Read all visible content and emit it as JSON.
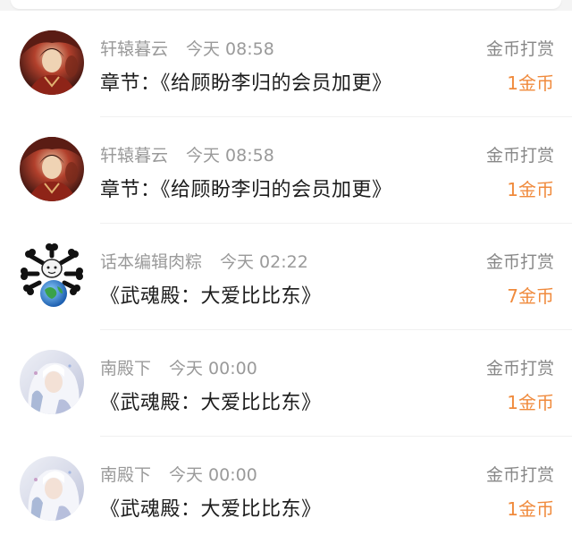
{
  "accent_color": "#f08a3c",
  "records": [
    {
      "username": "轩辕暮云",
      "time": "今天 08:58",
      "content": "章节：《给顾盼李归的会员加更》",
      "action": "金币打赏",
      "amount": "1金币",
      "avatar_icon": "anime-warrior-avatar-icon"
    },
    {
      "username": "轩辕暮云",
      "time": "今天 08:58",
      "content": "章节：《给顾盼李归的会员加更》",
      "action": "金币打赏",
      "amount": "1金币",
      "avatar_icon": "anime-warrior-avatar-icon"
    },
    {
      "username": "话本编辑肉粽",
      "time": "今天 02:22",
      "content": "《武魂殿：大爱比比东》",
      "action": "金币打赏",
      "amount": "7金币",
      "avatar_icon": "cartoon-earth-avatar-icon"
    },
    {
      "username": "南殿下",
      "time": "今天 00:00",
      "content": "《武魂殿：大爱比比东》",
      "action": "金币打赏",
      "amount": "1金币",
      "avatar_icon": "anime-silver-hair-avatar-icon"
    },
    {
      "username": "南殿下",
      "time": "今天 00:00",
      "content": "《武魂殿：大爱比比东》",
      "action": "金币打赏",
      "amount": "1金币",
      "avatar_icon": "anime-silver-hair-avatar-icon"
    }
  ]
}
